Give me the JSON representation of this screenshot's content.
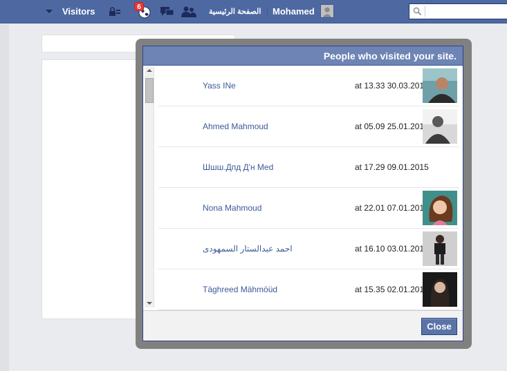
{
  "topbar": {
    "visitors_label": "Visitors",
    "notification_count": "6",
    "home_label": "الصفحة الرئيسية",
    "user_name": "Mohamed",
    "search_placeholder": "",
    "colors": {
      "bar": "#4e69a2",
      "badge": "#e33b3b"
    }
  },
  "dialog": {
    "title": "People who visited your site.",
    "close_label": "Close",
    "visitors": [
      {
        "name": "Yass INe",
        "time": "at 13.33 30.03.2015",
        "avatar": "photo-1"
      },
      {
        "name": "Ahmed Mahmoud",
        "time": "at 05.09 25.01.2015",
        "avatar": "photo-2"
      },
      {
        "name": "Шшш.Дпд Д'н Mеd",
        "time": "at 17.29 09.01.2015",
        "avatar": ""
      },
      {
        "name": "Nona Mahmoud",
        "time": "at 22.01 07.01.2015",
        "avatar": "photo-4"
      },
      {
        "name": "احمد عبدالستار السمهودى",
        "time": "at 16.10 03.01.2015",
        "avatar": "photo-5"
      },
      {
        "name": "Täghreed Mähmöüd",
        "time": "at 15.35 02.01.2015",
        "avatar": "photo-6"
      }
    ]
  }
}
